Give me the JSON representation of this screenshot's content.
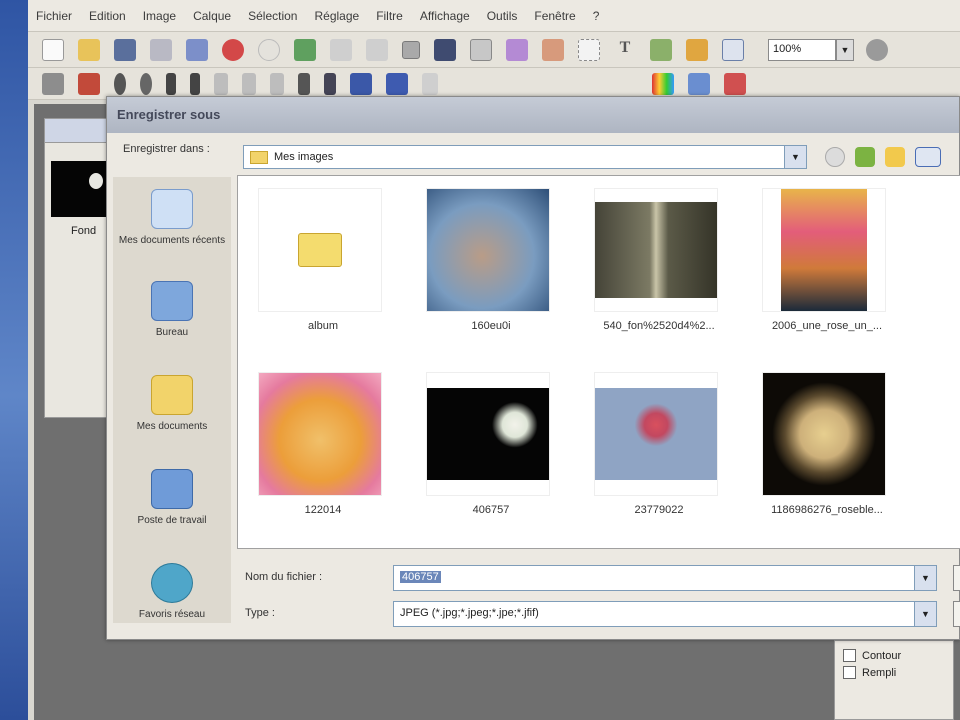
{
  "menu": [
    "Fichier",
    "Edition",
    "Image",
    "Calque",
    "Sélection",
    "Réglage",
    "Filtre",
    "Affichage",
    "Outils",
    "Fenêtre",
    "?"
  ],
  "toolbar": {
    "zoom_value": "100%"
  },
  "document": {
    "label": "Fond"
  },
  "right_panel": {
    "options": [
      "Contour",
      "Rempli"
    ]
  },
  "dialog": {
    "title": "Enregistrer sous",
    "save_in_label": "Enregistrer dans :",
    "save_in_value": "Mes images",
    "places": [
      "Mes documents récents",
      "Bureau",
      "Mes documents",
      "Poste de travail",
      "Favoris réseau"
    ],
    "files": [
      "album",
      "160eu0i",
      "540_fon%2520d4%2...",
      "2006_une_rose_un_...",
      "122014",
      "406757",
      "23779022",
      "1186986276_roseble..."
    ],
    "filename_label": "Nom du fichier :",
    "filename_value": "406757",
    "type_label": "Type :",
    "type_value": "JPEG (*.jpg;*.jpeg;*.jpe;*.jfif)"
  },
  "colors": {
    "titlebar": "#aeb5c2",
    "dialog_bg": "#ece9e2",
    "selection": "#6b87b9"
  }
}
